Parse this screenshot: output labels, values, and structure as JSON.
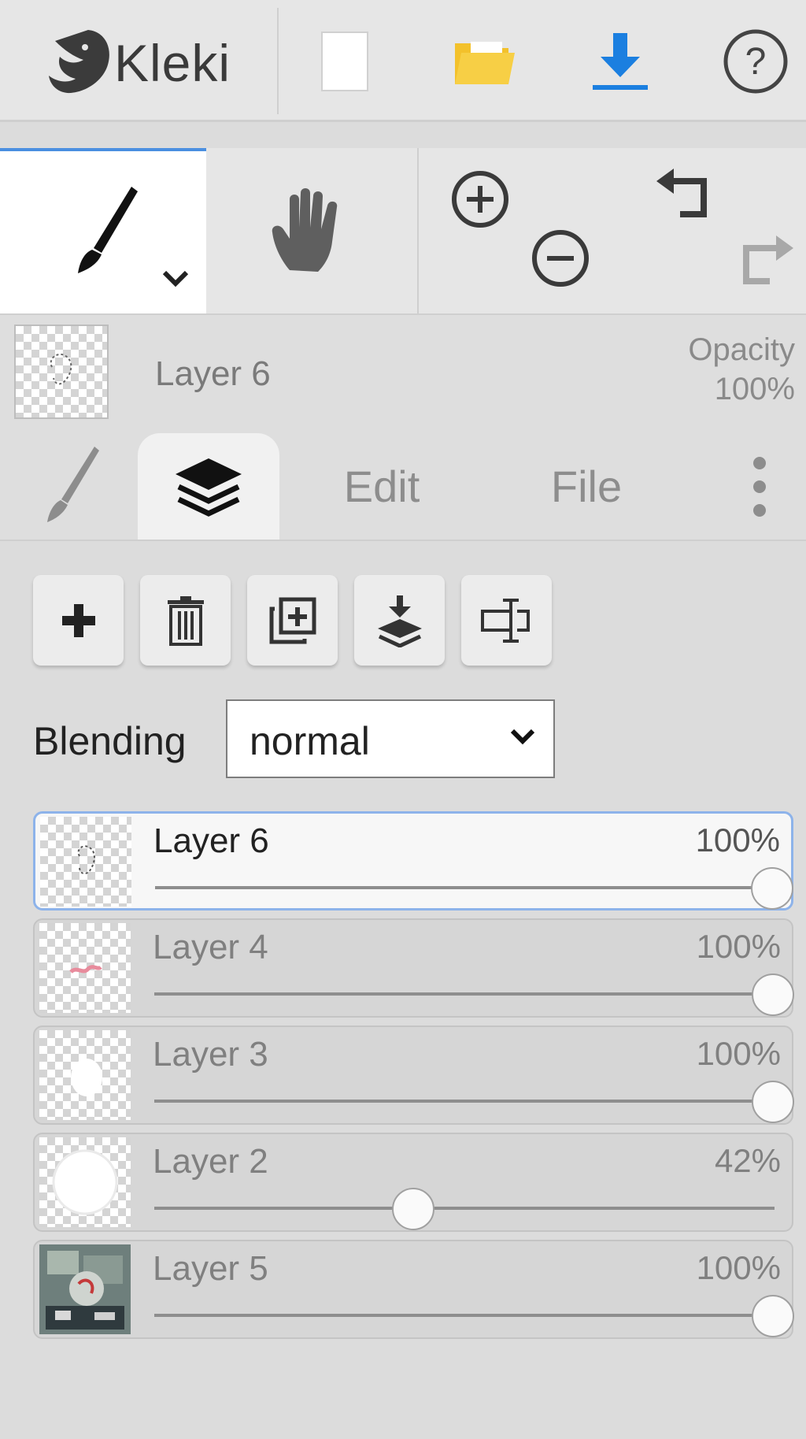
{
  "app": {
    "name": "Kleki"
  },
  "topbar": {
    "icons": [
      "new-document-icon",
      "open-folder-icon",
      "download-icon",
      "help-icon"
    ],
    "help_glyph": "?",
    "colors": {
      "folder": "#f3c12b",
      "download": "#1b7fe0"
    }
  },
  "tools": {
    "items": [
      "brush-tool",
      "hand-tool",
      "zoom-in",
      "zoom-out",
      "undo",
      "redo"
    ],
    "active": "brush-tool",
    "accent": "#4a8fe0"
  },
  "current_layer": {
    "name": "Layer 6",
    "opacity_label": "Opacity",
    "opacity_value": "100%"
  },
  "tabs": [
    {
      "id": "brush",
      "icon": "brush-icon",
      "label": ""
    },
    {
      "id": "layers",
      "icon": "layers-icon",
      "label": "",
      "active": true
    },
    {
      "id": "edit",
      "label": "Edit"
    },
    {
      "id": "file",
      "label": "File"
    },
    {
      "id": "more",
      "icon": "more-vertical-icon",
      "label": ""
    }
  ],
  "layer_actions": [
    "add-layer",
    "delete-layer",
    "duplicate-layer",
    "merge-down",
    "rename-layer"
  ],
  "blending": {
    "label": "Blending",
    "value": "normal"
  },
  "layers": [
    {
      "name": "Layer 6",
      "opacity": "100%",
      "opacity_fraction": 1.0,
      "selected": true
    },
    {
      "name": "Layer 4",
      "opacity": "100%",
      "opacity_fraction": 1.0,
      "selected": false
    },
    {
      "name": "Layer 3",
      "opacity": "100%",
      "opacity_fraction": 1.0,
      "selected": false
    },
    {
      "name": "Layer 2",
      "opacity": "42%",
      "opacity_fraction": 0.42,
      "selected": false
    },
    {
      "name": "Layer 5",
      "opacity": "100%",
      "opacity_fraction": 1.0,
      "selected": false
    }
  ]
}
